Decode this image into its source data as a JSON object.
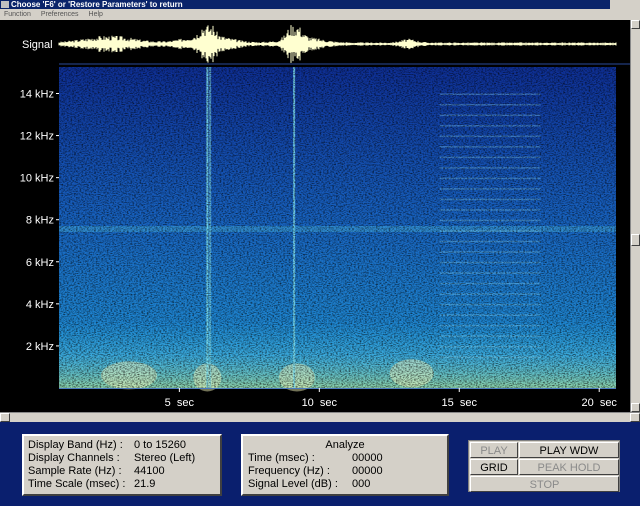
{
  "window": {
    "title": "Choose 'F6' or 'Restore Parameters' to return",
    "menu": [
      "Function",
      "Preferences",
      "Help"
    ]
  },
  "spectrogram": {
    "signal_label": "Signal",
    "freq_labels": [
      "14 kHz",
      "12 kHz",
      "10 kHz",
      "8 kHz",
      "6 kHz",
      "4 kHz",
      "2 kHz"
    ],
    "time_labels": [
      "5  sec",
      "10  sec",
      "15  sec",
      "20  sec"
    ]
  },
  "chart_data": {
    "type": "heatmap",
    "x_ticks": [
      5,
      10,
      15,
      20
    ],
    "x_tick_labels": [
      "5  sec",
      "10  sec",
      "15  sec",
      "20  sec"
    ],
    "y_ticks": [
      14,
      12,
      10,
      8,
      6,
      4,
      2
    ],
    "y_tick_labels": [
      "14 kHz",
      "12 kHz",
      "10 kHz",
      "8 kHz",
      "6 kHz",
      "4 kHz",
      "2 kHz"
    ],
    "xlim": [
      0.7,
      20.6
    ],
    "ylim": [
      0,
      15.26
    ],
    "colors": {
      "background": "#000000",
      "high": "#ffffc0",
      "mid": "#1e8cd2",
      "low": "#0a1e78",
      "waveform": "#ffffd0"
    }
  },
  "info": {
    "rows": [
      {
        "label": "Display Band (Hz)  :",
        "value": "0 to 15260"
      },
      {
        "label": "Display Channels  :",
        "value": "Stereo (Left)"
      },
      {
        "label": "Sample Rate (Hz)  :",
        "value": "44100"
      },
      {
        "label": "Time Scale (msec) :",
        "value": "21.9"
      }
    ]
  },
  "analyze": {
    "title": "Analyze",
    "rows": [
      {
        "label": "Time (msec)  :",
        "value": "00000"
      },
      {
        "label": "Frequency (Hz)  :",
        "value": "00000"
      },
      {
        "label": "Signal Level (dB)  :",
        "value": "000"
      }
    ]
  },
  "buttons": {
    "play": "PLAY",
    "play_wdw": "PLAY WDW",
    "grid": "GRID",
    "peak_hold": "PEAK HOLD",
    "stop": "STOP"
  }
}
